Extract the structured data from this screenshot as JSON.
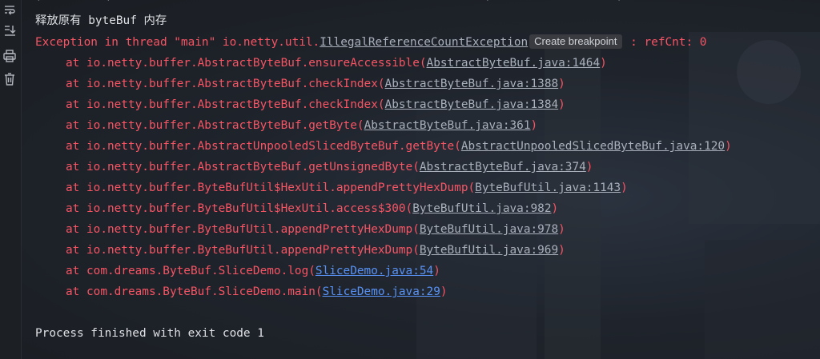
{
  "gutter": {
    "icons": [
      "soft-wrap-icon",
      "scroll-to-end-icon",
      "print-icon",
      "clear-all-icon"
    ]
  },
  "console": {
    "top_rule": "+--------+------------------------------------------------+----------------+",
    "info_line": "释放原有 byteBuf 内存",
    "exception": {
      "prefix": "Exception in thread \"main\" io.netty.util.",
      "class_link": "IllegalReferenceCountException",
      "breakpoint_label": "Create breakpoint",
      "suffix": " : refCnt: 0"
    },
    "frames": [
      {
        "method": "at io.netty.buffer.AbstractByteBuf.ensureAccessible(",
        "link": "AbstractByteBuf.java:1464",
        "close": ")"
      },
      {
        "method": "at io.netty.buffer.AbstractByteBuf.checkIndex(",
        "link": "AbstractByteBuf.java:1388",
        "close": ")"
      },
      {
        "method": "at io.netty.buffer.AbstractByteBuf.checkIndex(",
        "link": "AbstractByteBuf.java:1384",
        "close": ")"
      },
      {
        "method": "at io.netty.buffer.AbstractByteBuf.getByte(",
        "link": "AbstractByteBuf.java:361",
        "close": ")"
      },
      {
        "method": "at io.netty.buffer.AbstractUnpooledSlicedByteBuf.getByte(",
        "link": "AbstractUnpooledSlicedByteBuf.java:120",
        "close": ")"
      },
      {
        "method": "at io.netty.buffer.AbstractByteBuf.getUnsignedByte(",
        "link": "AbstractByteBuf.java:374",
        "close": ")"
      },
      {
        "method": "at io.netty.buffer.ByteBufUtil$HexUtil.appendPrettyHexDump(",
        "link": "ByteBufUtil.java:1143",
        "close": ")"
      },
      {
        "method": "at io.netty.buffer.ByteBufUtil$HexUtil.access$300(",
        "link": "ByteBufUtil.java:982",
        "close": ")"
      },
      {
        "method": "at io.netty.buffer.ByteBufUtil.appendPrettyHexDump(",
        "link": "ByteBufUtil.java:978",
        "close": ")"
      },
      {
        "method": "at io.netty.buffer.ByteBufUtil.appendPrettyHexDump(",
        "link": "ByteBufUtil.java:969",
        "close": ")"
      },
      {
        "method": "at com.dreams.ByteBuf.SliceDemo.log(",
        "link": "SliceDemo.java:54",
        "close": ")"
      },
      {
        "method": "at com.dreams.ByteBuf.SliceDemo.main(",
        "link": "SliceDemo.java:29",
        "close": ")"
      }
    ],
    "process_finished": "Process finished with exit code 1"
  },
  "colors": {
    "error": "#f75464",
    "library_link": "#a9b0bb",
    "source_link": "#5892f5",
    "text": "#dfe1e5",
    "background": "#1e2024"
  }
}
